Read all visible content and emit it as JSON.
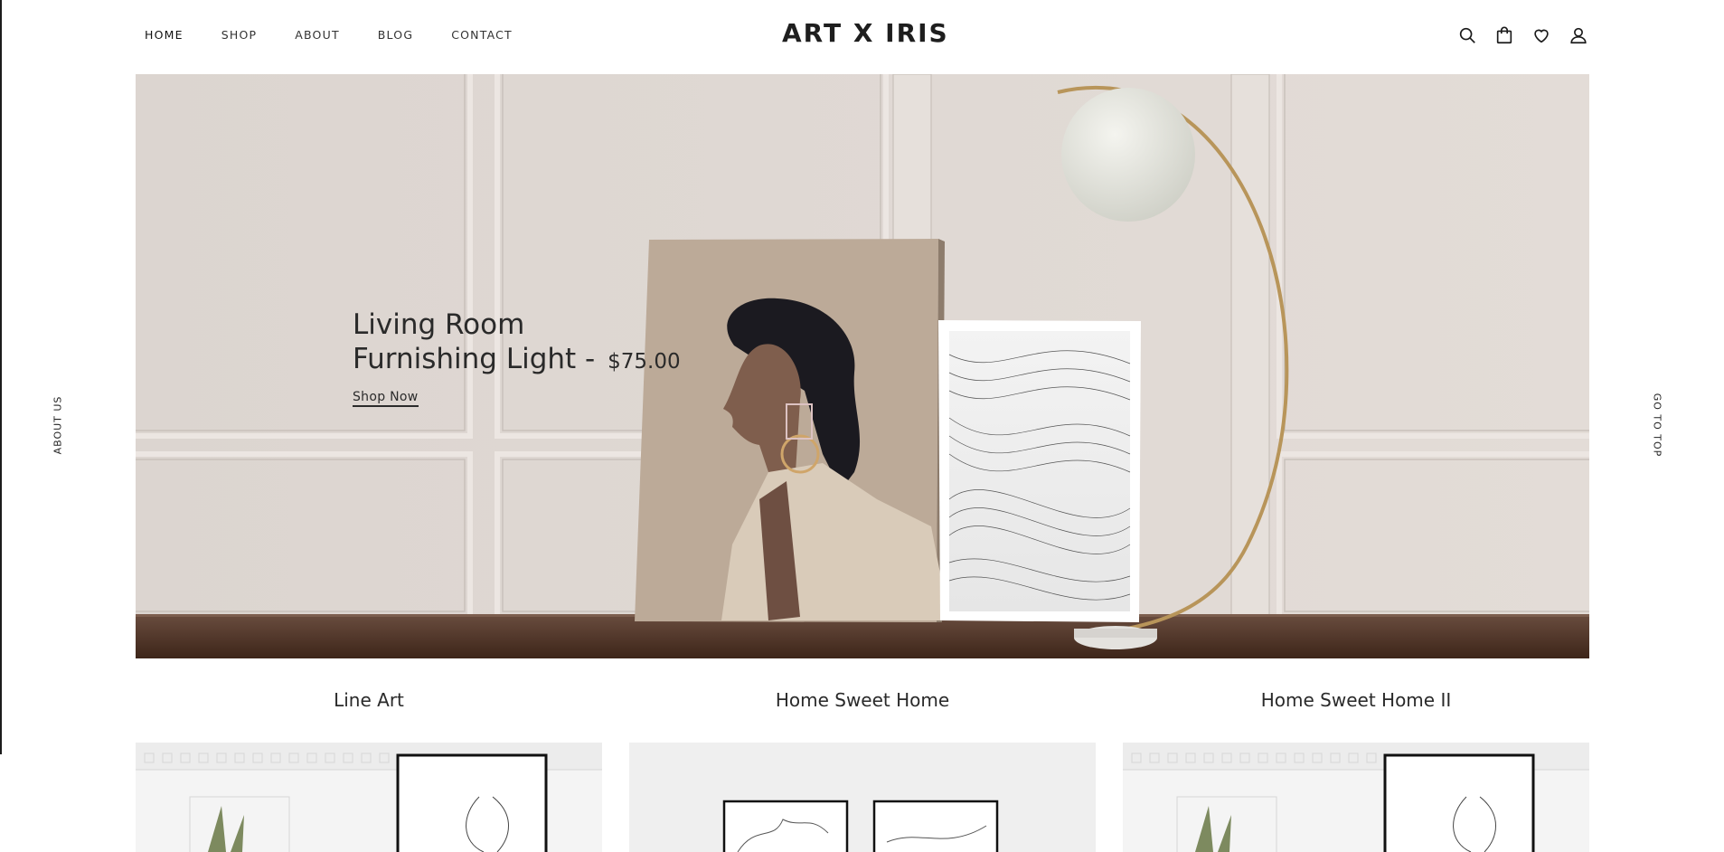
{
  "nav": {
    "items": [
      {
        "label": "HOME"
      },
      {
        "label": "SHOP"
      },
      {
        "label": "ABOUT"
      },
      {
        "label": "BLOG"
      },
      {
        "label": "CONTACT"
      }
    ]
  },
  "brand": "ART X IRIS",
  "header_icons": [
    "search-icon",
    "bag-icon",
    "heart-icon",
    "user-icon"
  ],
  "hero": {
    "title_line1": "Living Room",
    "title_line2": "Furnishing Light -",
    "price": "$75.00",
    "cta": "Shop Now"
  },
  "side": {
    "left": "ABOUT US",
    "right": "GO TO TOP"
  },
  "categories": [
    {
      "title": "Line Art"
    },
    {
      "title": "Home Sweet Home"
    },
    {
      "title": "Home Sweet Home II"
    }
  ],
  "colors": {
    "wall": "#ddd6d1",
    "table": "#4a2f22",
    "text": "#2a2a2a",
    "lamp_gold": "#b8955a"
  }
}
